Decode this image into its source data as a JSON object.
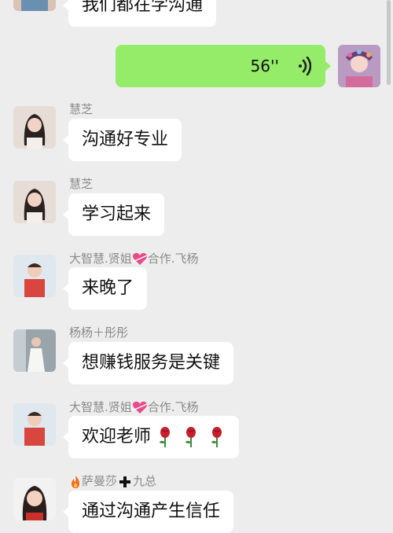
{
  "messages": [
    {
      "name": "",
      "text": "我们都在学沟通"
    },
    {
      "type": "voice",
      "duration": "56''"
    },
    {
      "name": "慧芝",
      "text": "沟通好专业"
    },
    {
      "name": "慧芝",
      "text": "学习起来"
    },
    {
      "name_parts": [
        "大智慧.贤姐",
        "合作.飞杨"
      ],
      "text": "来晚了"
    },
    {
      "name": "杨杨＋彤彤",
      "text": "想赚钱服务是关键"
    },
    {
      "name_parts": [
        "大智慧.贤姐",
        "合作.飞杨"
      ],
      "text": "欢迎老师"
    },
    {
      "name_parts": [
        "",
        "萨曼莎",
        "九总"
      ],
      "text": "通过沟通产生信任"
    }
  ],
  "colors": {
    "background": "#ededed",
    "incoming_bubble": "#ffffff",
    "outgoing_bubble": "#95ec69",
    "sender_name": "#8a8a8a"
  },
  "icons": [
    "voice-wave-icon",
    "heart-ribbon-icon",
    "rose-icon",
    "fire-icon",
    "plus-icon"
  ]
}
